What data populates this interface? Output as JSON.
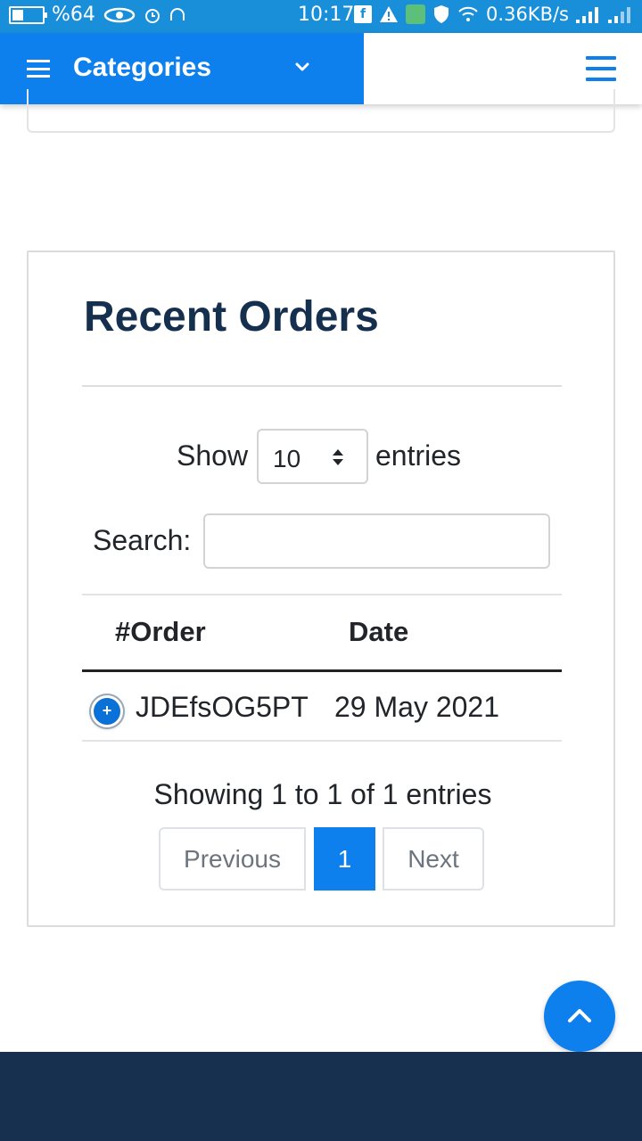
{
  "status_bar": {
    "battery_percent": "%64",
    "time": "10:17",
    "network_speed": "0.36KB/s",
    "icons": [
      "battery-icon",
      "eye-icon",
      "alarm-icon",
      "headphones-icon",
      "facebook-icon",
      "warning-icon",
      "app-icon",
      "shield-icon",
      "wifi-icon",
      "signal-icon",
      "signal-icon-2"
    ]
  },
  "nav": {
    "categories_label": "Categories",
    "menu_icon": "hamburger-icon",
    "chevron_icon": "chevron-down-icon"
  },
  "orders": {
    "title": "Recent Orders",
    "show_label": "Show",
    "show_value": "10",
    "entries_label": "entries",
    "search_label": "Search:",
    "search_value": "",
    "columns": [
      "#Order",
      "Date"
    ],
    "rows": [
      {
        "order": "JDEfsOG5PT",
        "date": "29 May 2021",
        "expand_icon": "plus-icon"
      }
    ],
    "info": "Showing 1 to 1 of 1 entries",
    "pagination": {
      "previous": "Previous",
      "current": "1",
      "next": "Next"
    }
  },
  "scroll_top_icon": "chevron-up-icon",
  "colors": {
    "primary": "#0d80ed",
    "status_bar": "#1a8fd9",
    "heading": "#152f4f",
    "footer": "#17304f"
  }
}
